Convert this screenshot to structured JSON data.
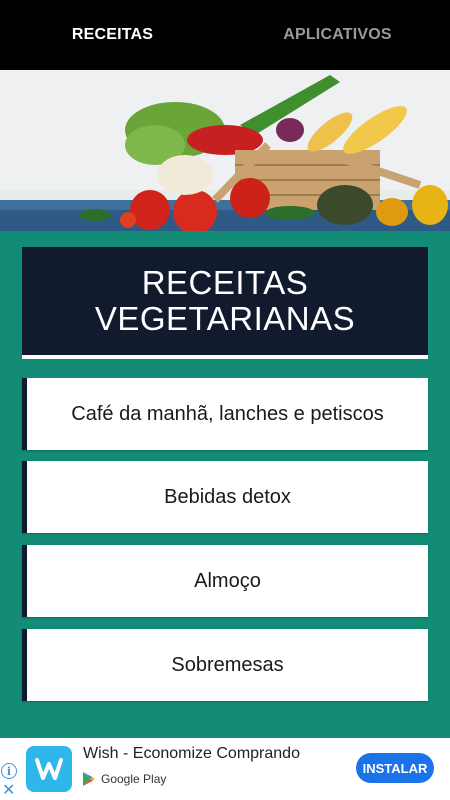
{
  "tabs": [
    {
      "label": "RECEITAS",
      "active": true
    },
    {
      "label": "APLICATIVOS",
      "active": false
    }
  ],
  "hero": {
    "image": "vegetables-basket-photo"
  },
  "title": "RECEITAS\nVEGETARIANAS",
  "menu": [
    {
      "label": "Café da manhã, lanches e petiscos"
    },
    {
      "label": "Bebidas detox"
    },
    {
      "label": "Almoço"
    },
    {
      "label": "Sobremesas"
    }
  ],
  "ad": {
    "title": "Wish - Economize Comprando",
    "store": "Google Play",
    "install_label": "INSTALAR",
    "info_icon": "info-icon",
    "close_icon": "close-icon"
  },
  "colors": {
    "background": "#128c76",
    "title_bg": "#121b2e",
    "tab_bar": "#000000",
    "install_button": "#1a73e8"
  }
}
